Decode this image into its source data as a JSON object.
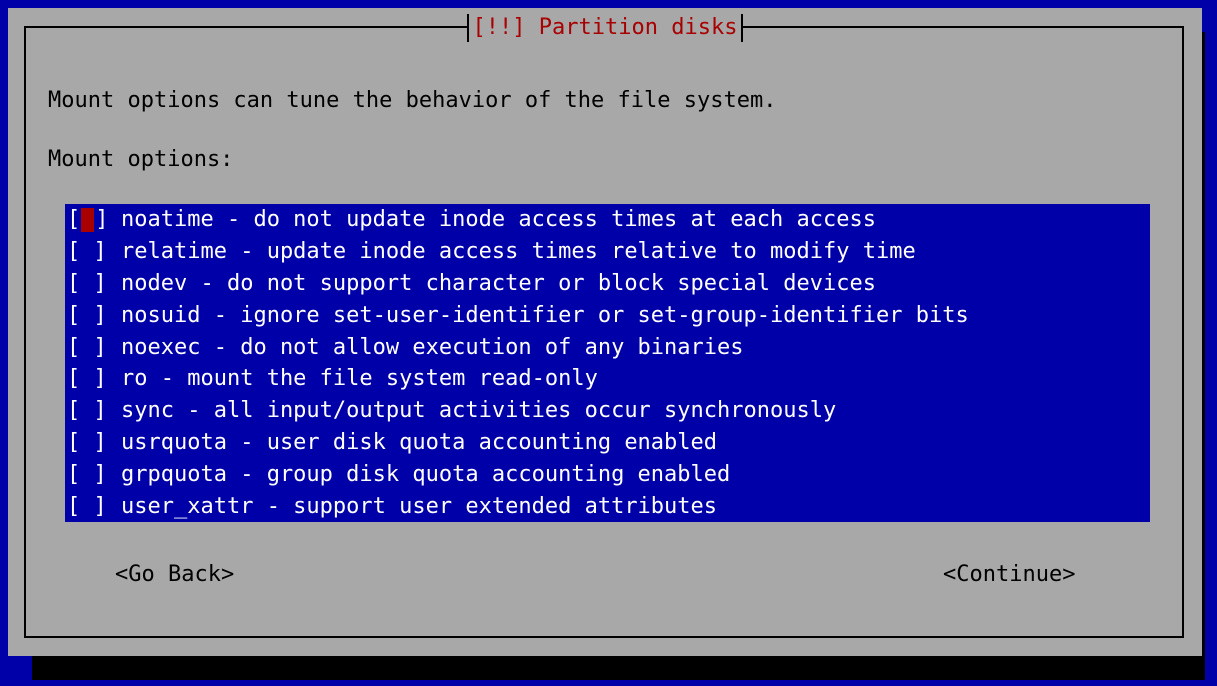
{
  "dialog": {
    "title": "[!!] Partition disks",
    "description": "Mount options can tune the behavior of the file system.",
    "list_label": "Mount options:"
  },
  "options": [
    {
      "checkbox": "[ ]",
      "label": "noatime - do not update inode access times at each access",
      "selected": false,
      "focused": true
    },
    {
      "checkbox": "[ ]",
      "label": "relatime - update inode access times relative to modify time",
      "selected": false,
      "focused": false
    },
    {
      "checkbox": "[ ]",
      "label": "nodev - do not support character or block special devices",
      "selected": false,
      "focused": false
    },
    {
      "checkbox": "[ ]",
      "label": "nosuid - ignore set-user-identifier or set-group-identifier bits",
      "selected": false,
      "focused": false
    },
    {
      "checkbox": "[ ]",
      "label": "noexec - do not allow execution of any binaries",
      "selected": false,
      "focused": false
    },
    {
      "checkbox": "[ ]",
      "label": "ro - mount the file system read-only",
      "selected": false,
      "focused": false
    },
    {
      "checkbox": "[ ]",
      "label": "sync - all input/output activities occur synchronously",
      "selected": false,
      "focused": false
    },
    {
      "checkbox": "[ ]",
      "label": "usrquota - user disk quota accounting enabled",
      "selected": false,
      "focused": false
    },
    {
      "checkbox": "[ ]",
      "label": "grpquota - group disk quota accounting enabled",
      "selected": false,
      "focused": false
    },
    {
      "checkbox": "[ ]",
      "label": "user_xattr - support user extended attributes",
      "selected": false,
      "focused": false
    }
  ],
  "buttons": {
    "back": "<Go Back>",
    "continue": "<Continue>"
  },
  "colors": {
    "background": "#0000a8",
    "dialog": "#a8a8a8",
    "title": "#a80000",
    "cursor": "#a80000",
    "list_text": "#ffffff"
  }
}
